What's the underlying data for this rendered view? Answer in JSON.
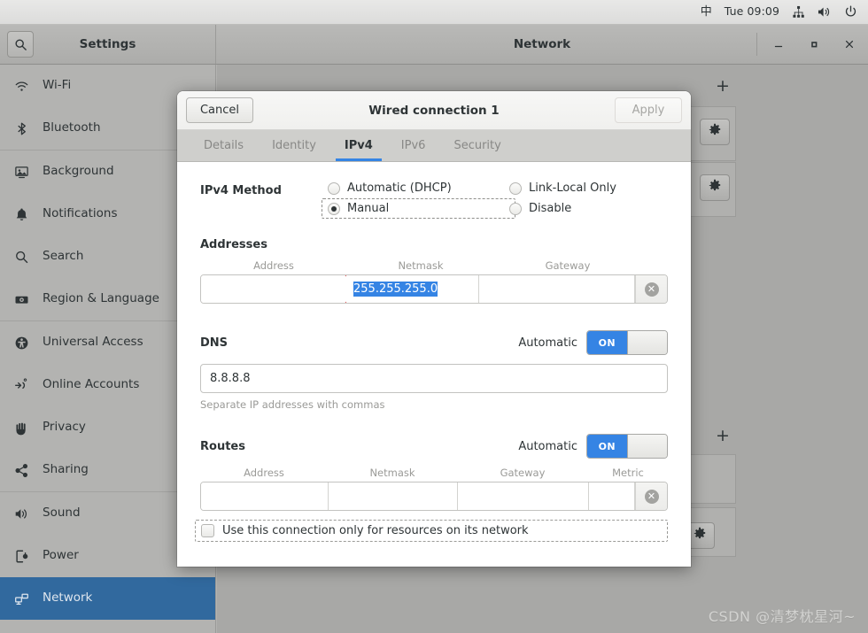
{
  "topbar": {
    "ime": "中",
    "clock": "Tue 09:09",
    "icons": [
      "network-icon",
      "volume-icon",
      "power-icon"
    ]
  },
  "settings_window": {
    "title": "Settings",
    "search_icon": "search-icon"
  },
  "network_window": {
    "title": "Network",
    "minimize": "_",
    "maximize": "□",
    "close": "✕",
    "add_label": "+"
  },
  "sidebar": {
    "items": [
      {
        "label": "Wi-Fi",
        "icon": "wifi-icon",
        "selected": false
      },
      {
        "label": "Bluetooth",
        "icon": "bluetooth-icon",
        "selected": false
      },
      {
        "label": "Background",
        "icon": "background-icon",
        "selected": false
      },
      {
        "label": "Notifications",
        "icon": "bell-icon",
        "selected": false
      },
      {
        "label": "Search",
        "icon": "search-icon",
        "selected": false
      },
      {
        "label": "Region & Language",
        "icon": "region-icon",
        "selected": false
      },
      {
        "label": "Universal Access",
        "icon": "accessibility-icon",
        "selected": false
      },
      {
        "label": "Online Accounts",
        "icon": "online-accounts-icon",
        "selected": false
      },
      {
        "label": "Privacy",
        "icon": "hand-icon",
        "selected": false
      },
      {
        "label": "Sharing",
        "icon": "share-icon",
        "selected": false
      },
      {
        "label": "Sound",
        "icon": "speaker-icon",
        "selected": false
      },
      {
        "label": "Power",
        "icon": "power-plug-icon",
        "selected": false
      },
      {
        "label": "Network",
        "icon": "network-icon",
        "selected": true
      }
    ]
  },
  "dialog": {
    "title": "Wired connection 1",
    "cancel_label": "Cancel",
    "apply_label": "Apply",
    "apply_disabled": true,
    "tabs": [
      {
        "label": "Details",
        "active": false
      },
      {
        "label": "Identity",
        "active": false
      },
      {
        "label": "IPv4",
        "active": true
      },
      {
        "label": "IPv6",
        "active": false
      },
      {
        "label": "Security",
        "active": false
      }
    ],
    "ipv4_method": {
      "label": "IPv4 Method",
      "options": [
        {
          "label": "Automatic (DHCP)",
          "checked": false,
          "focused": false
        },
        {
          "label": "Link-Local Only",
          "checked": false,
          "focused": false
        },
        {
          "label": "Manual",
          "checked": true,
          "focused": true
        },
        {
          "label": "Disable",
          "checked": false,
          "focused": false
        }
      ]
    },
    "addresses": {
      "label": "Addresses",
      "columns": [
        "Address",
        "Netmask",
        "Gateway"
      ],
      "rows": [
        {
          "address": "",
          "netmask": "255.255.255.0",
          "netmask_selected": true,
          "gateway": "",
          "address_error": true,
          "delete_icon": "delete-circle-icon"
        }
      ]
    },
    "dns": {
      "label": "DNS",
      "automatic_label": "Automatic",
      "toggle_state": "ON",
      "value": "8.8.8.8",
      "hint": "Separate IP addresses with commas"
    },
    "routes": {
      "label": "Routes",
      "automatic_label": "Automatic",
      "toggle_state": "ON",
      "columns": [
        "Address",
        "Netmask",
        "Gateway",
        "Metric"
      ],
      "rows": [
        {
          "address": "",
          "netmask": "",
          "gateway": "",
          "metric": "",
          "delete_icon": "delete-circle-icon"
        }
      ]
    },
    "restrict_checkbox": {
      "label": "Use this connection only for resources on its network",
      "checked": false
    }
  },
  "colors": {
    "accent": "#3584e4",
    "selected_sidebar": "#31699e",
    "error_border": "#cc0000",
    "toggle_on": "#3584e4"
  },
  "watermark": "CSDN @清梦枕星河~"
}
